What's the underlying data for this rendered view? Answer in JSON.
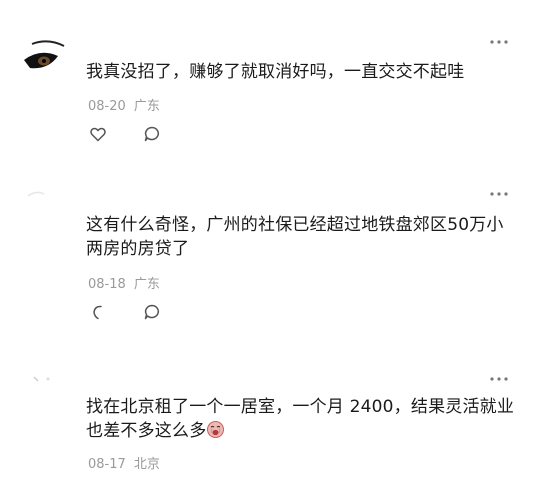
{
  "comments": [
    {
      "username": "",
      "text": "我真没招了，赚够了就取消好吗，一直交交不起哇",
      "date": "08-20",
      "location": "广东",
      "has_emoji": false
    },
    {
      "username": "",
      "text": "这有什么奇怪，广州的社保已经超过地铁盘郊区50万小两房的房贷了",
      "date": "08-18",
      "location": "广东",
      "has_emoji": false
    },
    {
      "username": "",
      "text": "找在北京租了一个一居室，一个月 2400，结果灵活就业也差不多这么多",
      "date": "08-17",
      "location": "北京",
      "has_emoji": true
    }
  ],
  "icons": {
    "more": "more-dots-icon",
    "like": "heart-icon",
    "reply": "comment-bubble-icon",
    "emoji": "crying-face-emoji-icon"
  },
  "colors": {
    "text": "#1a1a1a",
    "meta": "#9a9a9a",
    "icon": "#555555"
  }
}
